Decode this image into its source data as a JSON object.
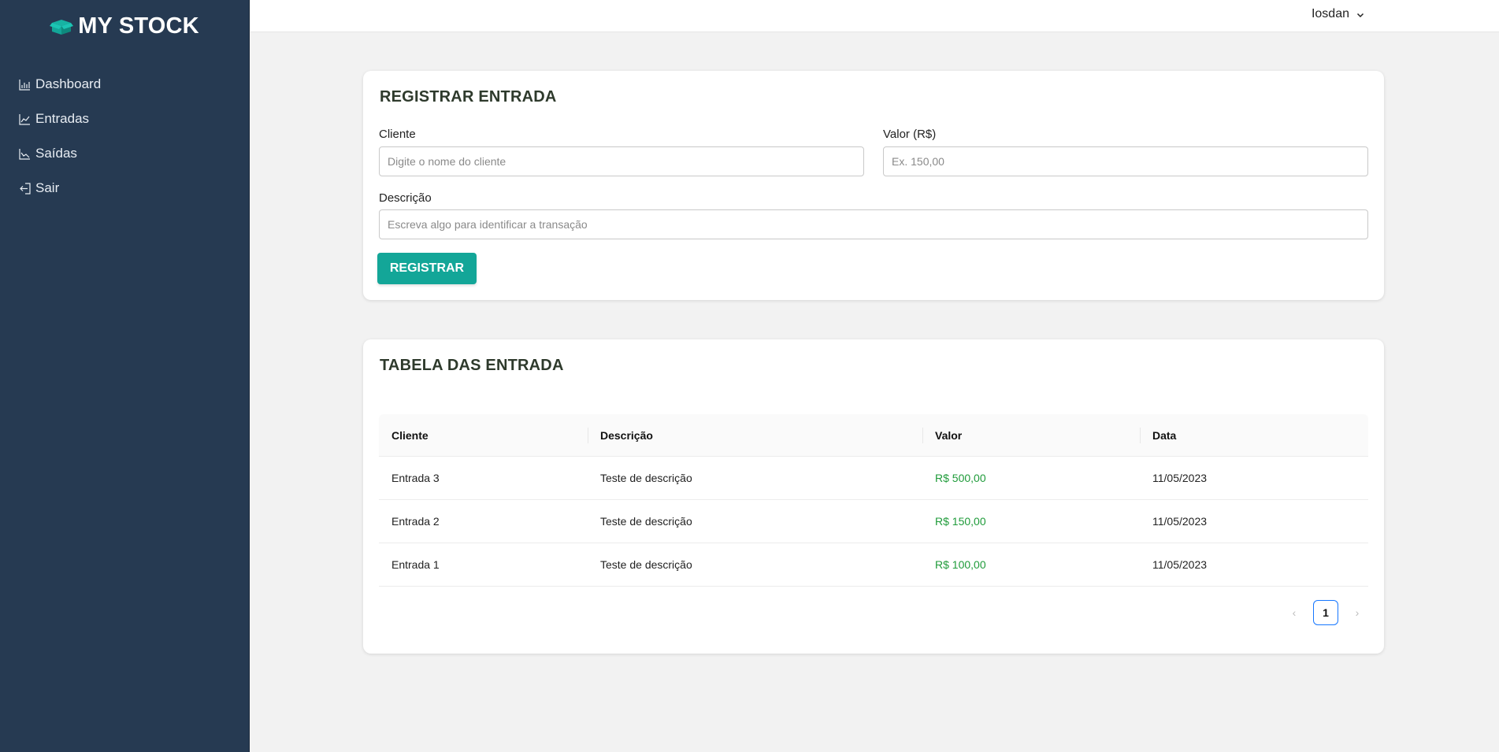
{
  "sidebar": {
    "brand": "MY STOCK",
    "brand_icon": "box-icon",
    "brand_icon_color": "#13a698",
    "items": [
      {
        "label": "Dashboard",
        "icon": "bar-chart-icon"
      },
      {
        "label": "Entradas",
        "icon": "line-chart-icon"
      },
      {
        "label": "Saídas",
        "icon": "area-chart-icon"
      },
      {
        "label": "Sair",
        "icon": "logout-icon"
      }
    ]
  },
  "header": {
    "user": "Iosdan"
  },
  "form": {
    "title": "REGISTRAR ENTRADA",
    "cliente_label": "Cliente",
    "cliente_placeholder": "Digite o nome do cliente",
    "valor_label": "Valor (R$)",
    "valor_placeholder": "Ex. 150,00",
    "descricao_label": "Descrição",
    "descricao_placeholder": "Escreva algo para identificar a transação",
    "submit_label": "REGISTRAR",
    "accent_color": "#13a698"
  },
  "table": {
    "title": "TABELA DAS ENTRADA",
    "columns": [
      "Cliente",
      "Descrição",
      "Valor",
      "Data"
    ],
    "rows": [
      {
        "cliente": "Entrada 3",
        "descricao": "Teste de descrição",
        "valor": "R$ 500,00",
        "data": "11/05/2023"
      },
      {
        "cliente": "Entrada 2",
        "descricao": "Teste de descrição",
        "valor": "R$ 150,00",
        "data": "11/05/2023"
      },
      {
        "cliente": "Entrada 1",
        "descricao": "Teste de descrição",
        "valor": "R$ 100,00",
        "data": "11/05/2023"
      }
    ],
    "value_color": "#1f9b3a",
    "pagination": {
      "prev": "‹",
      "current": "1",
      "next": "›"
    }
  },
  "colors": {
    "sidebar_bg": "#263a52",
    "page_bg": "#f2f2f2"
  }
}
